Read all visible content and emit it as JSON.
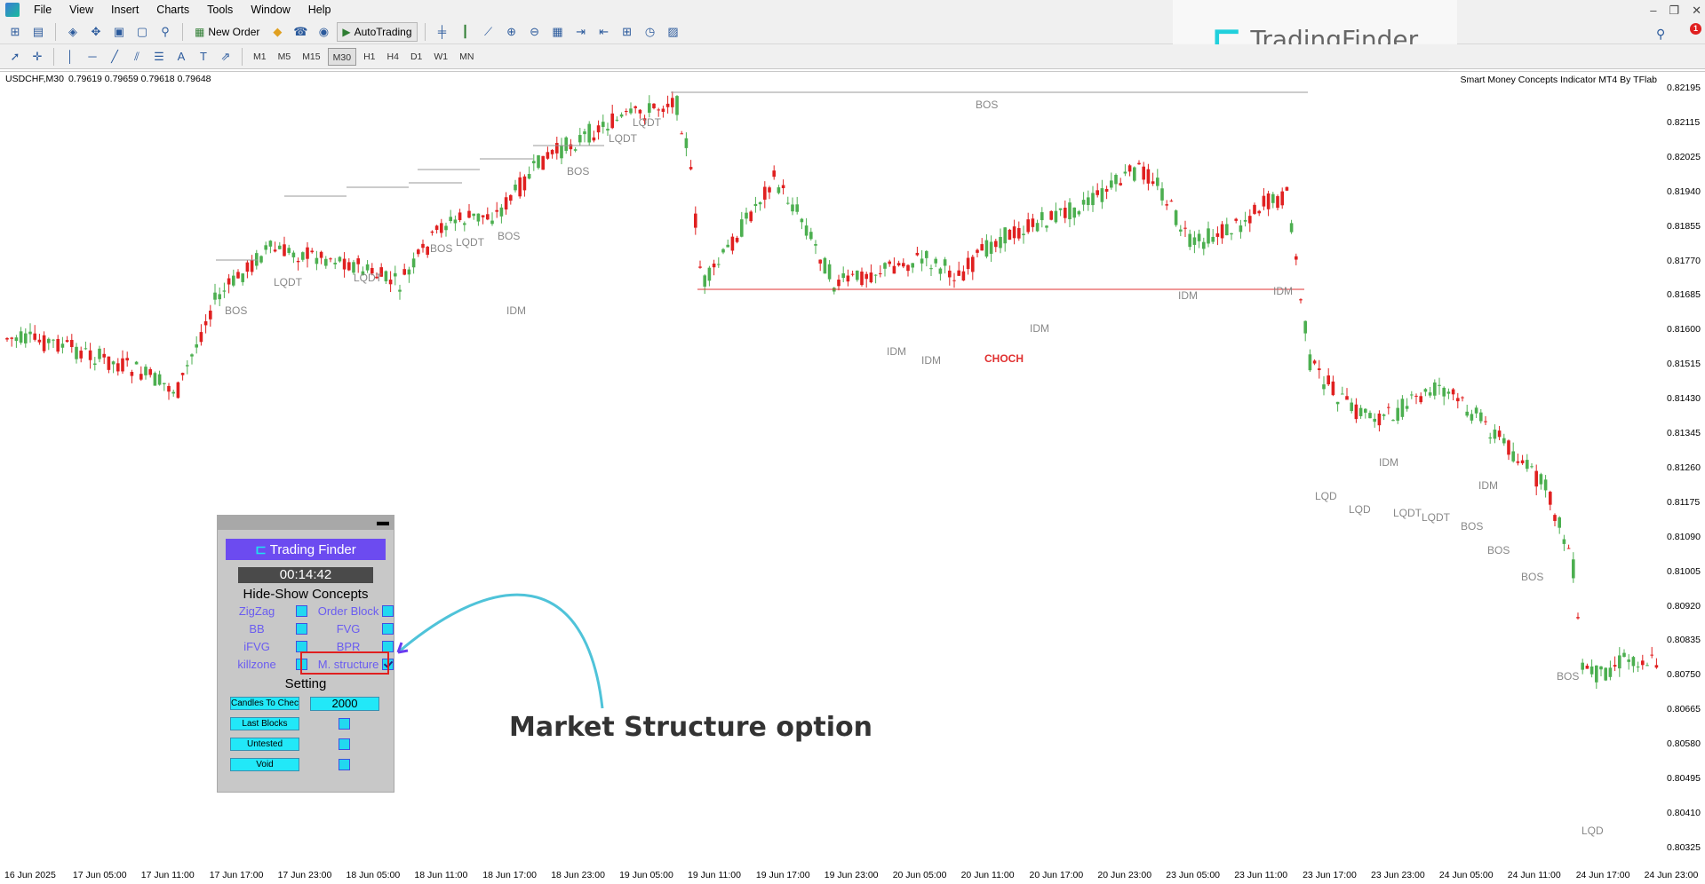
{
  "menu": [
    "File",
    "View",
    "Insert",
    "Charts",
    "Tools",
    "Window",
    "Help"
  ],
  "toolbar": {
    "new_order": "New Order",
    "auto_trading": "AutoTrading",
    "timeframes": [
      "M1",
      "M5",
      "M15",
      "M30",
      "H1",
      "H4",
      "D1",
      "W1",
      "MN"
    ],
    "active_timeframe": "M30"
  },
  "brand": {
    "logo_text": "TradingFinder",
    "notification_count": "1"
  },
  "chart": {
    "symbol": "USDCHF,M30",
    "ohlc": "0.79619 0.79659 0.79618 0.79648",
    "indicator_title": "Smart Money Concepts Indicator MT4 By TFlab",
    "price_labels": [
      "0.82195",
      "0.82115",
      "0.82025",
      "0.81940",
      "0.81855",
      "0.81770",
      "0.81685",
      "0.81600",
      "0.81515",
      "0.81430",
      "0.81345",
      "0.81260",
      "0.81175",
      "0.81090",
      "0.81005",
      "0.80920",
      "0.80835",
      "0.80750",
      "0.80665",
      "0.80580",
      "0.80495",
      "0.80410",
      "0.80325"
    ],
    "time_labels": [
      "16 Jun 2025",
      "17 Jun 05:00",
      "17 Jun 11:00",
      "17 Jun 17:00",
      "17 Jun 23:00",
      "18 Jun 05:00",
      "18 Jun 11:00",
      "18 Jun 17:00",
      "18 Jun 23:00",
      "19 Jun 05:00",
      "19 Jun 11:00",
      "19 Jun 17:00",
      "19 Jun 23:00",
      "20 Jun 05:00",
      "20 Jun 11:00",
      "20 Jun 17:00",
      "20 Jun 23:00",
      "23 Jun 05:00",
      "23 Jun 11:00",
      "23 Jun 17:00",
      "23 Jun 23:00",
      "24 Jun 05:00",
      "24 Jun 11:00",
      "24 Jun 17:00",
      "24 Jun 23:00"
    ],
    "markers": {
      "bos": "BOS",
      "lqdt": "LQDT",
      "lqd": "LQD",
      "idm": "IDM",
      "choch": "CHOCH"
    },
    "colors": {
      "bull": "#4caf50",
      "bear": "#e02020",
      "structure": "#999999",
      "choch": "#e03030"
    }
  },
  "panel": {
    "logo_text": "Trading Finder",
    "timer": "00:14:42",
    "hide_show_heading": "Hide-Show Concepts",
    "options": [
      {
        "left": "ZigZag",
        "right": "Order Block"
      },
      {
        "left": "BB",
        "right": "FVG"
      },
      {
        "left": "iFVG",
        "right": "BPR"
      },
      {
        "left": "killzone",
        "right": "M. structure"
      }
    ],
    "setting_heading": "Setting",
    "settings": {
      "candles_label": "Candles To Check",
      "candles_value": "2000",
      "last_blocks": "Last Blocks",
      "untested": "Untested",
      "void": "Void"
    }
  },
  "annotation": "Market Structure option"
}
